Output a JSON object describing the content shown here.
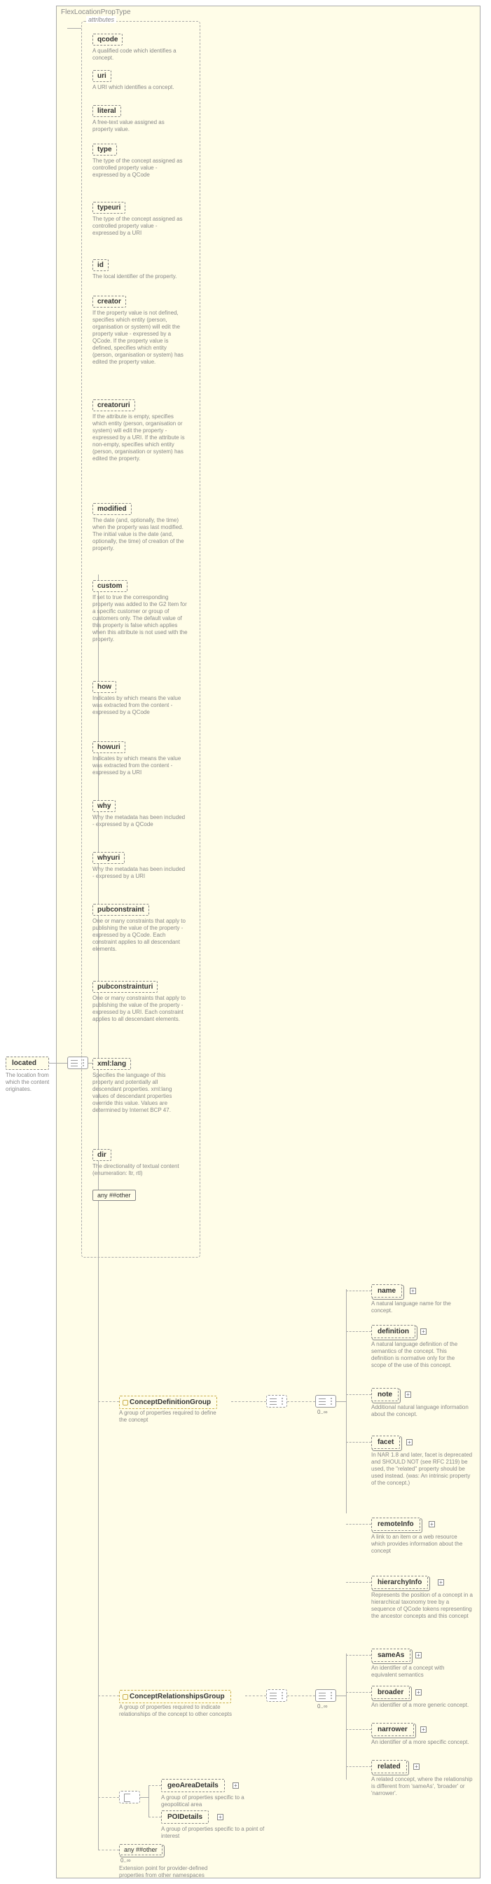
{
  "typeLabel": "FlexLocationPropType",
  "root": {
    "name": "located",
    "desc": "The location from which the content originates."
  },
  "attributesLabel": "attributes",
  "attributes": [
    {
      "name": "qcode",
      "desc": "A qualified code which identifies a concept."
    },
    {
      "name": "uri",
      "desc": "A URI which identifies a concept."
    },
    {
      "name": "literal",
      "desc": "A free-text value assigned as property value."
    },
    {
      "name": "type",
      "desc": "The type of the concept assigned as controlled property value - expressed by a QCode"
    },
    {
      "name": "typeuri",
      "desc": "The type of the concept assigned as controlled property value - expressed by a URI"
    },
    {
      "name": "id",
      "desc": "The local identifier of the property."
    },
    {
      "name": "creator",
      "desc": "If the property value is not defined, specifies which entity (person, organisation or system) will edit the property value - expressed by a QCode. If the property value is defined, specifies which entity (person, organisation or system) has edited the property value."
    },
    {
      "name": "creatoruri",
      "desc": "If the attribute is empty, specifies which entity (person, organisation or system) will edit the property - expressed by a URI. If the attribute is non-empty, specifies which entity (person, organisation or system) has edited the property."
    },
    {
      "name": "modified",
      "desc": "The date (and, optionally, the time) when the property was last modified. The initial value is the date (and, optionally, the time) of creation of the property."
    },
    {
      "name": "custom",
      "desc": "If set to true the corresponding property was added to the G2 Item for a specific customer or group of customers only. The default value of this property is false which applies when this attribute is not used with the property."
    },
    {
      "name": "how",
      "desc": "Indicates by which means the value was extracted from the content - expressed by a QCode"
    },
    {
      "name": "howuri",
      "desc": "Indicates by which means the value was extracted from the content - expressed by a URI"
    },
    {
      "name": "why",
      "desc": "Why the metadata has been included - expressed by a QCode"
    },
    {
      "name": "whyuri",
      "desc": "Why the metadata has been included - expressed by a URI"
    },
    {
      "name": "pubconstraint",
      "desc": "One or many constraints that apply to publishing the value of the property - expressed by a QCode. Each constraint applies to all descendant elements."
    },
    {
      "name": "pubconstrainturi",
      "desc": "One or many constraints that apply to publishing the value of the property - expressed by a URI. Each constraint applies to all descendant elements."
    },
    {
      "name": "xml:lang",
      "desc": "Specifies the language of this property and potentially all descendant properties. xml:lang values of descendant properties override this value. Values are determined by Internet BCP 47."
    },
    {
      "name": "dir",
      "desc": "The directionality of textual content (enumeration: ltr, rtl)"
    }
  ],
  "anyAttr": "any ##other",
  "groups": {
    "defGroup": {
      "name": "ConceptDefinitionGroup",
      "desc": "A group of properties required to define the concept"
    },
    "relGroup": {
      "name": "ConceptRelationshipsGroup",
      "desc": "A group of properties required to indicate relationships of the concept to other concepts"
    },
    "geo": {
      "name": "geoAreaDetails",
      "desc": "A group of properties specific to a geopolitical area"
    },
    "poi": {
      "name": "POIDetails",
      "desc": "A group of properties specific to a point of interest"
    }
  },
  "defChildren": [
    {
      "name": "name",
      "desc": "A natural language name for the concept."
    },
    {
      "name": "definition",
      "desc": "A natural language definition of the semantics of the concept. This definition is normative only for the scope of the use of this concept."
    },
    {
      "name": "note",
      "desc": "Additional natural language information about the concept."
    },
    {
      "name": "facet",
      "desc": "In NAR 1.8 and later, facet is deprecated and SHOULD NOT (see RFC 2119) be used, the \"related\" property should be used instead. (was: An intrinsic property of the concept.)"
    },
    {
      "name": "remoteInfo",
      "desc": "A link to an item or a web resource which provides information about the concept"
    },
    {
      "name": "hierarchyInfo",
      "desc": "Represents the position of a concept in a hierarchical taxonomy tree by a sequence of QCode tokens representing the ancestor concepts and this concept"
    }
  ],
  "relChildren": [
    {
      "name": "sameAs",
      "desc": "An identifier of a concept with equivalent semantics"
    },
    {
      "name": "broader",
      "desc": "An identifier of a more generic concept."
    },
    {
      "name": "narrower",
      "desc": "An identifier of a more specific concept."
    },
    {
      "name": "related",
      "desc": "A related concept, where the relationship is different from 'sameAs', 'broader' or 'narrower'."
    }
  ],
  "bottomAny": {
    "label": "any ##other",
    "desc": "Extension point for provider-defined properties from other namespaces"
  },
  "multLabel": "0..∞"
}
